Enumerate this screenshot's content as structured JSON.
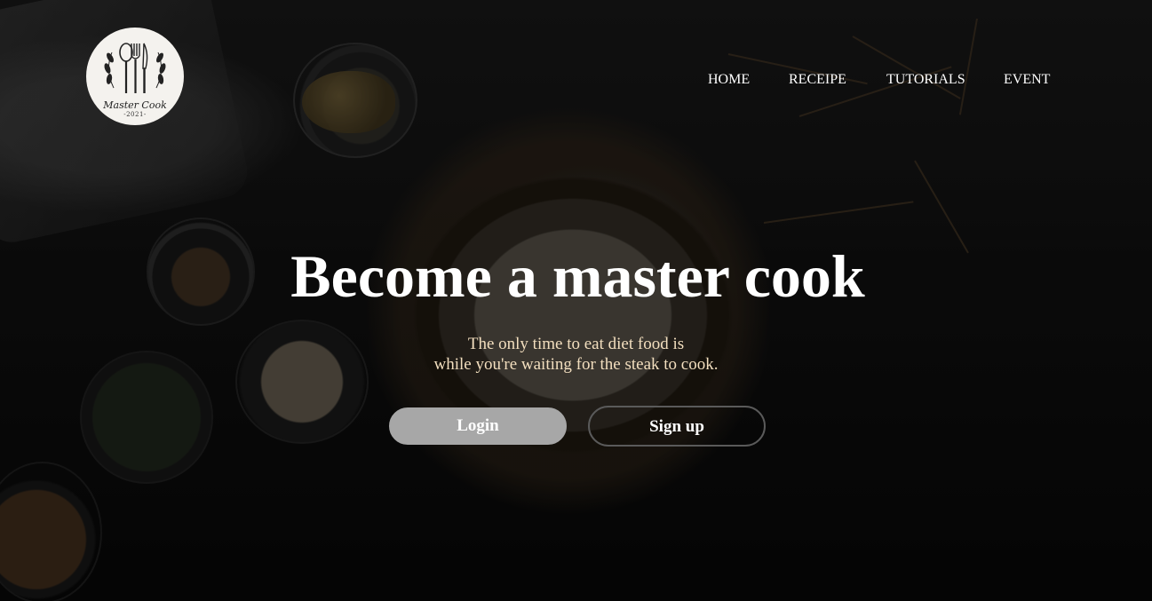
{
  "brand": {
    "logo_name": "Master Cook",
    "logo_year": "-2021-"
  },
  "nav": {
    "items": [
      {
        "label": "HOME"
      },
      {
        "label": "RECEIPE"
      },
      {
        "label": "TUTORIALS"
      },
      {
        "label": "EVENT"
      }
    ]
  },
  "hero": {
    "title": "Become a master cook",
    "subtitle_line1": "The only time to eat diet food is",
    "subtitle_line2": "while you're waiting for the steak to cook.",
    "login_label": "Login",
    "signup_label": "Sign up"
  },
  "colors": {
    "subtitle": "#f3dfbf",
    "login_bg": "#a7a7a7",
    "text": "#ffffff"
  }
}
